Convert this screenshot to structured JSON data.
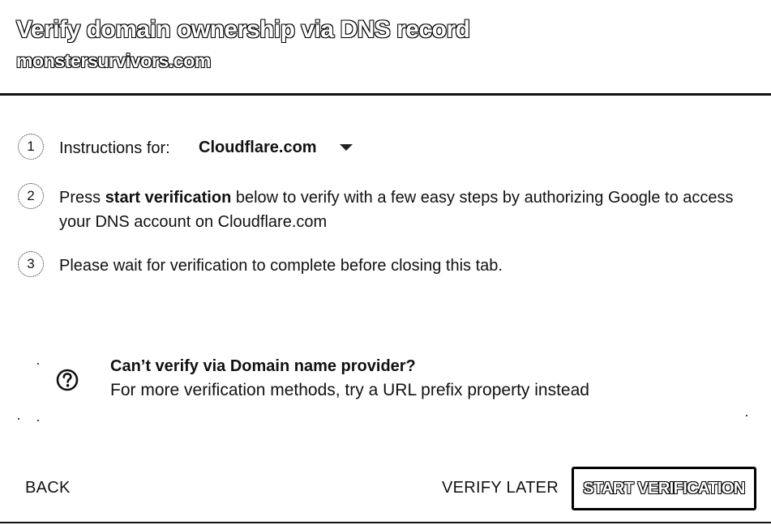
{
  "header": {
    "title": "Verify domain ownership via DNS record",
    "domain": "monstersurvivors.com"
  },
  "steps": [
    {
      "number": "1",
      "label": "Instructions for:",
      "provider_select": {
        "selected": "Cloudflare.com"
      }
    },
    {
      "number": "2",
      "text_prefix": "Press ",
      "text_bold": "start verification",
      "text_suffix": " below to verify with a few easy steps by authorizing Google to access your DNS account on Cloudflare.com"
    },
    {
      "number": "3",
      "text": "Please wait for verification to complete before closing this tab."
    }
  ],
  "help": {
    "icon": "help-circle-icon",
    "title": "Can’t verify via Domain name provider?",
    "description": "For more verification methods, try a URL prefix property instead"
  },
  "actions": {
    "back": "BACK",
    "verify_later": "VERIFY LATER",
    "start_verification": "START VERIFICATION"
  }
}
